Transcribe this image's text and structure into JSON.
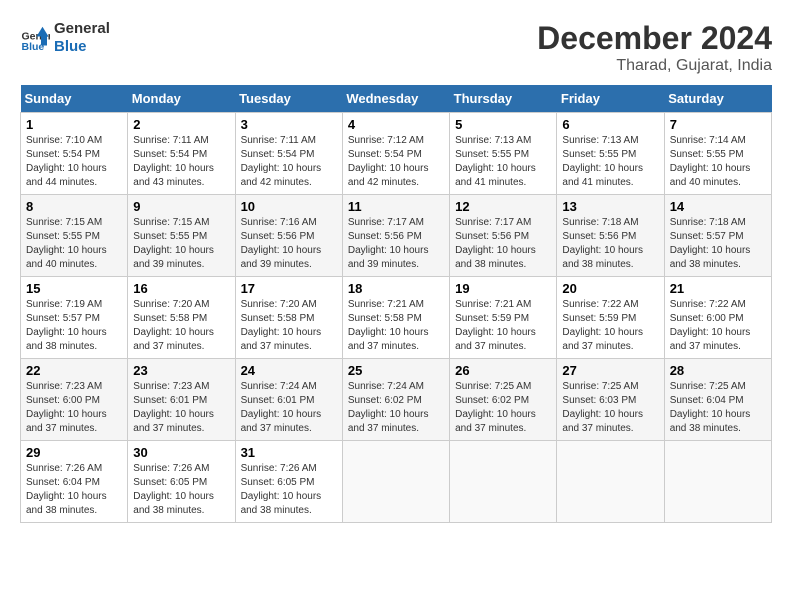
{
  "header": {
    "logo_line1": "General",
    "logo_line2": "Blue",
    "month_year": "December 2024",
    "location": "Tharad, Gujarat, India"
  },
  "days_of_week": [
    "Sunday",
    "Monday",
    "Tuesday",
    "Wednesday",
    "Thursday",
    "Friday",
    "Saturday"
  ],
  "weeks": [
    [
      {
        "day": "1",
        "sunrise": "7:10 AM",
        "sunset": "5:54 PM",
        "daylight": "10 hours and 44 minutes."
      },
      {
        "day": "2",
        "sunrise": "7:11 AM",
        "sunset": "5:54 PM",
        "daylight": "10 hours and 43 minutes."
      },
      {
        "day": "3",
        "sunrise": "7:11 AM",
        "sunset": "5:54 PM",
        "daylight": "10 hours and 42 minutes."
      },
      {
        "day": "4",
        "sunrise": "7:12 AM",
        "sunset": "5:54 PM",
        "daylight": "10 hours and 42 minutes."
      },
      {
        "day": "5",
        "sunrise": "7:13 AM",
        "sunset": "5:55 PM",
        "daylight": "10 hours and 41 minutes."
      },
      {
        "day": "6",
        "sunrise": "7:13 AM",
        "sunset": "5:55 PM",
        "daylight": "10 hours and 41 minutes."
      },
      {
        "day": "7",
        "sunrise": "7:14 AM",
        "sunset": "5:55 PM",
        "daylight": "10 hours and 40 minutes."
      }
    ],
    [
      {
        "day": "8",
        "sunrise": "7:15 AM",
        "sunset": "5:55 PM",
        "daylight": "10 hours and 40 minutes."
      },
      {
        "day": "9",
        "sunrise": "7:15 AM",
        "sunset": "5:55 PM",
        "daylight": "10 hours and 39 minutes."
      },
      {
        "day": "10",
        "sunrise": "7:16 AM",
        "sunset": "5:56 PM",
        "daylight": "10 hours and 39 minutes."
      },
      {
        "day": "11",
        "sunrise": "7:17 AM",
        "sunset": "5:56 PM",
        "daylight": "10 hours and 39 minutes."
      },
      {
        "day": "12",
        "sunrise": "7:17 AM",
        "sunset": "5:56 PM",
        "daylight": "10 hours and 38 minutes."
      },
      {
        "day": "13",
        "sunrise": "7:18 AM",
        "sunset": "5:56 PM",
        "daylight": "10 hours and 38 minutes."
      },
      {
        "day": "14",
        "sunrise": "7:18 AM",
        "sunset": "5:57 PM",
        "daylight": "10 hours and 38 minutes."
      }
    ],
    [
      {
        "day": "15",
        "sunrise": "7:19 AM",
        "sunset": "5:57 PM",
        "daylight": "10 hours and 38 minutes."
      },
      {
        "day": "16",
        "sunrise": "7:20 AM",
        "sunset": "5:58 PM",
        "daylight": "10 hours and 37 minutes."
      },
      {
        "day": "17",
        "sunrise": "7:20 AM",
        "sunset": "5:58 PM",
        "daylight": "10 hours and 37 minutes."
      },
      {
        "day": "18",
        "sunrise": "7:21 AM",
        "sunset": "5:58 PM",
        "daylight": "10 hours and 37 minutes."
      },
      {
        "day": "19",
        "sunrise": "7:21 AM",
        "sunset": "5:59 PM",
        "daylight": "10 hours and 37 minutes."
      },
      {
        "day": "20",
        "sunrise": "7:22 AM",
        "sunset": "5:59 PM",
        "daylight": "10 hours and 37 minutes."
      },
      {
        "day": "21",
        "sunrise": "7:22 AM",
        "sunset": "6:00 PM",
        "daylight": "10 hours and 37 minutes."
      }
    ],
    [
      {
        "day": "22",
        "sunrise": "7:23 AM",
        "sunset": "6:00 PM",
        "daylight": "10 hours and 37 minutes."
      },
      {
        "day": "23",
        "sunrise": "7:23 AM",
        "sunset": "6:01 PM",
        "daylight": "10 hours and 37 minutes."
      },
      {
        "day": "24",
        "sunrise": "7:24 AM",
        "sunset": "6:01 PM",
        "daylight": "10 hours and 37 minutes."
      },
      {
        "day": "25",
        "sunrise": "7:24 AM",
        "sunset": "6:02 PM",
        "daylight": "10 hours and 37 minutes."
      },
      {
        "day": "26",
        "sunrise": "7:25 AM",
        "sunset": "6:02 PM",
        "daylight": "10 hours and 37 minutes."
      },
      {
        "day": "27",
        "sunrise": "7:25 AM",
        "sunset": "6:03 PM",
        "daylight": "10 hours and 37 minutes."
      },
      {
        "day": "28",
        "sunrise": "7:25 AM",
        "sunset": "6:04 PM",
        "daylight": "10 hours and 38 minutes."
      }
    ],
    [
      {
        "day": "29",
        "sunrise": "7:26 AM",
        "sunset": "6:04 PM",
        "daylight": "10 hours and 38 minutes."
      },
      {
        "day": "30",
        "sunrise": "7:26 AM",
        "sunset": "6:05 PM",
        "daylight": "10 hours and 38 minutes."
      },
      {
        "day": "31",
        "sunrise": "7:26 AM",
        "sunset": "6:05 PM",
        "daylight": "10 hours and 38 minutes."
      },
      null,
      null,
      null,
      null
    ]
  ],
  "labels": {
    "sunrise_prefix": "Sunrise: ",
    "sunset_prefix": "Sunset: ",
    "daylight_prefix": "Daylight: "
  }
}
